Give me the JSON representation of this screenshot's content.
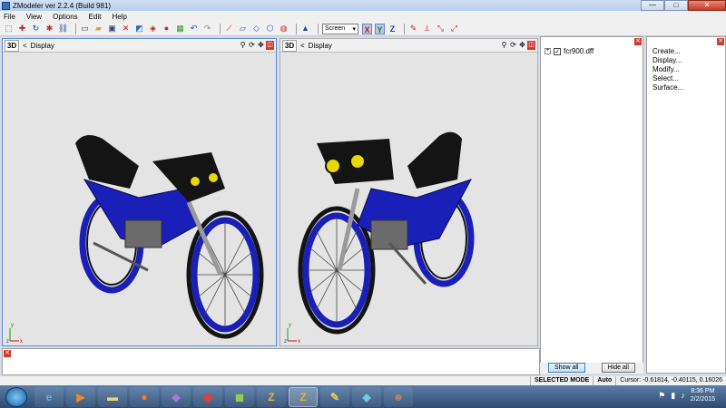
{
  "window": {
    "title": "ZModeler ver 2.2.4 (Build 981)",
    "minimize": "—",
    "maximize": "□",
    "close": "✕"
  },
  "menu": [
    "File",
    "View",
    "Options",
    "Edit",
    "Help"
  ],
  "toolbar": {
    "screen_mode": "Screen",
    "axes": [
      "X",
      "Y",
      "Z"
    ]
  },
  "viewports": [
    {
      "mode": "3D",
      "label": "Display",
      "arrow": "<"
    },
    {
      "mode": "3D",
      "label": "Display",
      "arrow": "<"
    }
  ],
  "axis_gizmo": {
    "y": "y",
    "z": "z",
    "x": "x"
  },
  "tree": {
    "items": [
      {
        "expander": "+",
        "checked": "✓",
        "label": "fcr900.dff"
      }
    ],
    "show_all": "Show all",
    "hide_all": "Hide all"
  },
  "commands": [
    "Create...",
    "Display...",
    "Modify...",
    "Select...",
    "Surface..."
  ],
  "status": {
    "mode": "SELECTED MODE",
    "auto": "Auto",
    "cursor": "Cursor: -0.61814, -0.40115, 0.16026"
  },
  "clock": {
    "time": "8:36 PM",
    "date": "2/2/2015"
  },
  "colors": {
    "bike_blue": "#1a1fb8",
    "bike_black": "#141414",
    "rim_blue": "#2020c8",
    "accent_yellow": "#e8d800",
    "viewport_bg": "#e4e4e4"
  }
}
